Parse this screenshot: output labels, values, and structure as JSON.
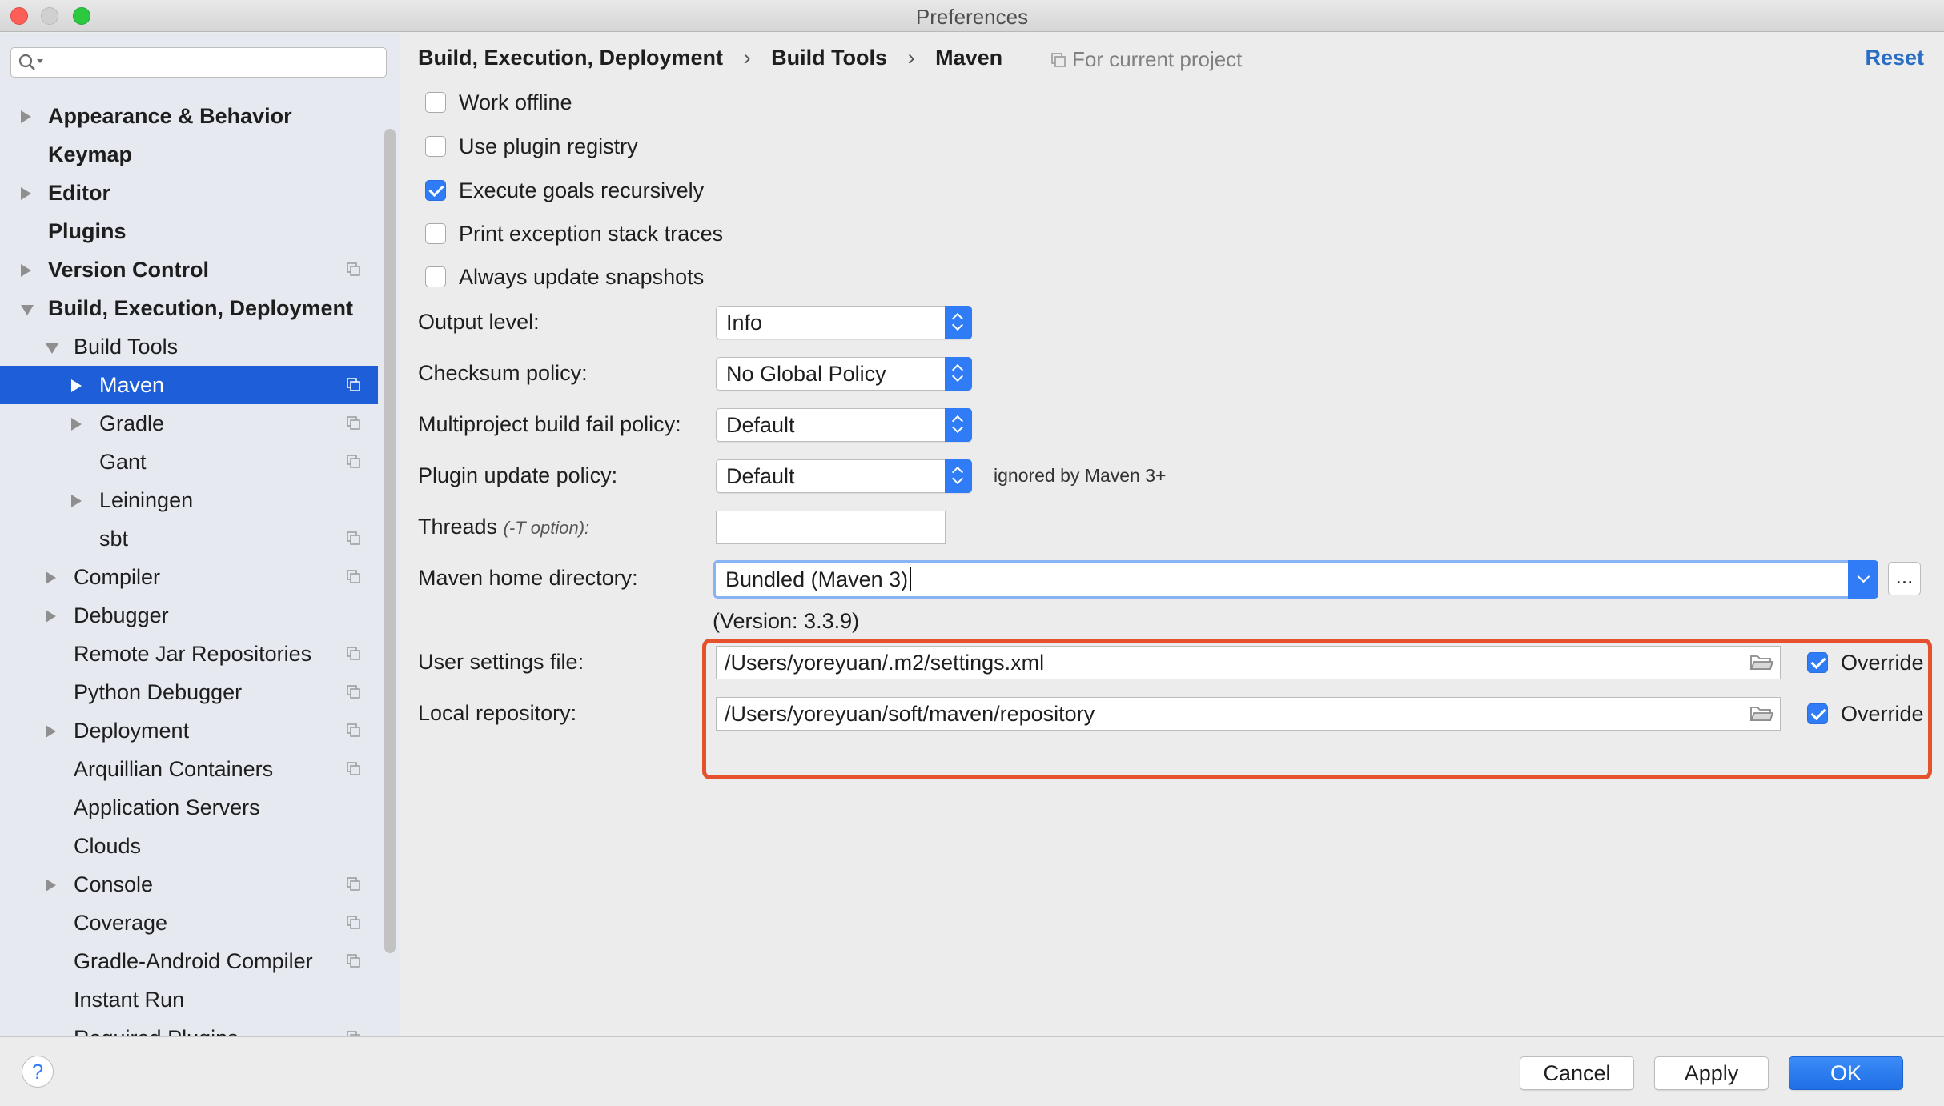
{
  "window": {
    "title": "Preferences"
  },
  "sidebar": {
    "search_placeholder": "",
    "items": [
      {
        "label": "Appearance & Behavior",
        "indent": 0,
        "arrow": "right",
        "bold": true,
        "proj": false,
        "selected": false
      },
      {
        "label": "Keymap",
        "indent": 0,
        "arrow": "none",
        "bold": true,
        "proj": false,
        "selected": false
      },
      {
        "label": "Editor",
        "indent": 0,
        "arrow": "right",
        "bold": true,
        "proj": false,
        "selected": false
      },
      {
        "label": "Plugins",
        "indent": 0,
        "arrow": "none",
        "bold": true,
        "proj": false,
        "selected": false
      },
      {
        "label": "Version Control",
        "indent": 0,
        "arrow": "right",
        "bold": true,
        "proj": true,
        "selected": false
      },
      {
        "label": "Build, Execution, Deployment",
        "indent": 0,
        "arrow": "down",
        "bold": true,
        "proj": false,
        "selected": false
      },
      {
        "label": "Build Tools",
        "indent": 1,
        "arrow": "down",
        "bold": false,
        "proj": false,
        "selected": false
      },
      {
        "label": "Maven",
        "indent": 2,
        "arrow": "right",
        "bold": false,
        "proj": true,
        "selected": true
      },
      {
        "label": "Gradle",
        "indent": 2,
        "arrow": "right",
        "bold": false,
        "proj": true,
        "selected": false
      },
      {
        "label": "Gant",
        "indent": 2,
        "arrow": "none",
        "bold": false,
        "proj": true,
        "selected": false
      },
      {
        "label": "Leiningen",
        "indent": 2,
        "arrow": "right",
        "bold": false,
        "proj": false,
        "selected": false
      },
      {
        "label": "sbt",
        "indent": 2,
        "arrow": "none",
        "bold": false,
        "proj": true,
        "selected": false
      },
      {
        "label": "Compiler",
        "indent": 1,
        "arrow": "right",
        "bold": false,
        "proj": true,
        "selected": false
      },
      {
        "label": "Debugger",
        "indent": 1,
        "arrow": "right",
        "bold": false,
        "proj": false,
        "selected": false
      },
      {
        "label": "Remote Jar Repositories",
        "indent": 1,
        "arrow": "none",
        "bold": false,
        "proj": true,
        "selected": false
      },
      {
        "label": "Python Debugger",
        "indent": 1,
        "arrow": "none",
        "bold": false,
        "proj": true,
        "selected": false
      },
      {
        "label": "Deployment",
        "indent": 1,
        "arrow": "right",
        "bold": false,
        "proj": true,
        "selected": false
      },
      {
        "label": "Arquillian Containers",
        "indent": 1,
        "arrow": "none",
        "bold": false,
        "proj": true,
        "selected": false
      },
      {
        "label": "Application Servers",
        "indent": 1,
        "arrow": "none",
        "bold": false,
        "proj": false,
        "selected": false
      },
      {
        "label": "Clouds",
        "indent": 1,
        "arrow": "none",
        "bold": false,
        "proj": false,
        "selected": false
      },
      {
        "label": "Console",
        "indent": 1,
        "arrow": "right",
        "bold": false,
        "proj": true,
        "selected": false
      },
      {
        "label": "Coverage",
        "indent": 1,
        "arrow": "none",
        "bold": false,
        "proj": true,
        "selected": false
      },
      {
        "label": "Gradle-Android Compiler",
        "indent": 1,
        "arrow": "none",
        "bold": false,
        "proj": true,
        "selected": false
      },
      {
        "label": "Instant Run",
        "indent": 1,
        "arrow": "none",
        "bold": false,
        "proj": false,
        "selected": false
      },
      {
        "label": "Required Plugins",
        "indent": 1,
        "arrow": "none",
        "bold": false,
        "proj": true,
        "selected": false
      }
    ]
  },
  "header": {
    "crumbs": [
      "Build, Execution, Deployment",
      "Build Tools",
      "Maven"
    ],
    "separator": "›",
    "scope": "For current project",
    "reset_label": "Reset"
  },
  "options": {
    "work_offline": {
      "label": "Work offline",
      "checked": false
    },
    "use_plugin_registry": {
      "label": "Use plugin registry",
      "checked": false
    },
    "execute_goals": {
      "label": "Execute goals recursively",
      "checked": true
    },
    "print_exception": {
      "label": "Print exception stack traces",
      "checked": false
    },
    "always_update": {
      "label": "Always update snapshots",
      "checked": false
    }
  },
  "form": {
    "output_level": {
      "label": "Output level:",
      "value": "Info"
    },
    "checksum_policy": {
      "label": "Checksum policy:",
      "value": "No Global Policy"
    },
    "multiproject_policy": {
      "label": "Multiproject build fail policy:",
      "value": "Default"
    },
    "plugin_update_policy": {
      "label": "Plugin update policy:",
      "value": "Default",
      "hint": "ignored by Maven 3+"
    },
    "threads": {
      "label": "Threads",
      "option": "(-T option):",
      "value": ""
    },
    "maven_home": {
      "label": "Maven home directory:",
      "value": "Bundled (Maven 3)",
      "browse_label": "..."
    },
    "version": "(Version: 3.3.9)",
    "user_settings": {
      "label": "User settings file:",
      "value": "/Users/yoreyuan/.m2/settings.xml",
      "override_label": "Override",
      "override": true
    },
    "local_repo": {
      "label": "Local repository:",
      "value": "/Users/yoreyuan/soft/maven/repository",
      "override_label": "Override",
      "override": true
    }
  },
  "footer": {
    "help_label": "?",
    "cancel_label": "Cancel",
    "apply_label": "Apply",
    "ok_label": "OK"
  },
  "colors": {
    "accent": "#2f7cf6",
    "selection": "#1e5ed8",
    "highlight": "#e5502d",
    "link": "#2a6dc4"
  }
}
